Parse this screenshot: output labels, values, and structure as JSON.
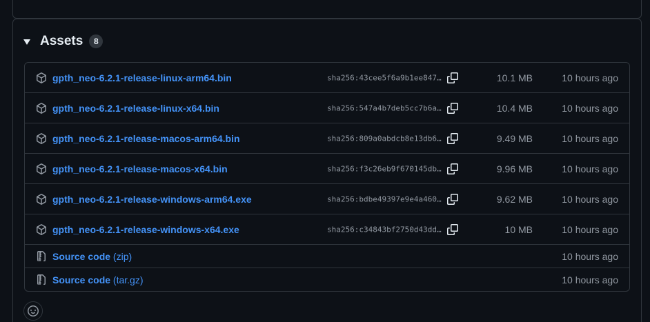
{
  "assets": {
    "title": "Assets",
    "count": "8",
    "rows": [
      {
        "name": "gpth_neo-6.2.1-release-linux-arm64.bin",
        "sha": "sha256:43cee5f6a9b1ee847…",
        "size": "10.1 MB",
        "time": "10 hours ago",
        "icon": "package-icon"
      },
      {
        "name": "gpth_neo-6.2.1-release-linux-x64.bin",
        "sha": "sha256:547a4b7deb5cc7b6a…",
        "size": "10.4 MB",
        "time": "10 hours ago",
        "icon": "package-icon"
      },
      {
        "name": "gpth_neo-6.2.1-release-macos-arm64.bin",
        "sha": "sha256:809a0abdcb8e13db6…",
        "size": "9.49 MB",
        "time": "10 hours ago",
        "icon": "package-icon"
      },
      {
        "name": "gpth_neo-6.2.1-release-macos-x64.bin",
        "sha": "sha256:f3c26eb9f670145db…",
        "size": "9.96 MB",
        "time": "10 hours ago",
        "icon": "package-icon"
      },
      {
        "name": "gpth_neo-6.2.1-release-windows-arm64.exe",
        "sha": "sha256:bdbe49397e9e4a460…",
        "size": "9.62 MB",
        "time": "10 hours ago",
        "icon": "package-icon"
      },
      {
        "name": "gpth_neo-6.2.1-release-windows-x64.exe",
        "sha": "sha256:c34843bf2750d43dd…",
        "size": "10 MB",
        "time": "10 hours ago",
        "icon": "package-icon"
      }
    ],
    "source": [
      {
        "label": "Source code",
        "ext": "(zip)",
        "time": "10 hours ago",
        "icon": "file-zip-icon"
      },
      {
        "label": "Source code",
        "ext": "(tar.gz)",
        "time": "10 hours ago",
        "icon": "file-zip-icon"
      }
    ]
  },
  "colors": {
    "background": "#0d1117",
    "border": "#30363d",
    "link": "#4493f8",
    "muted": "#9198a1",
    "text": "#e6edf3"
  }
}
